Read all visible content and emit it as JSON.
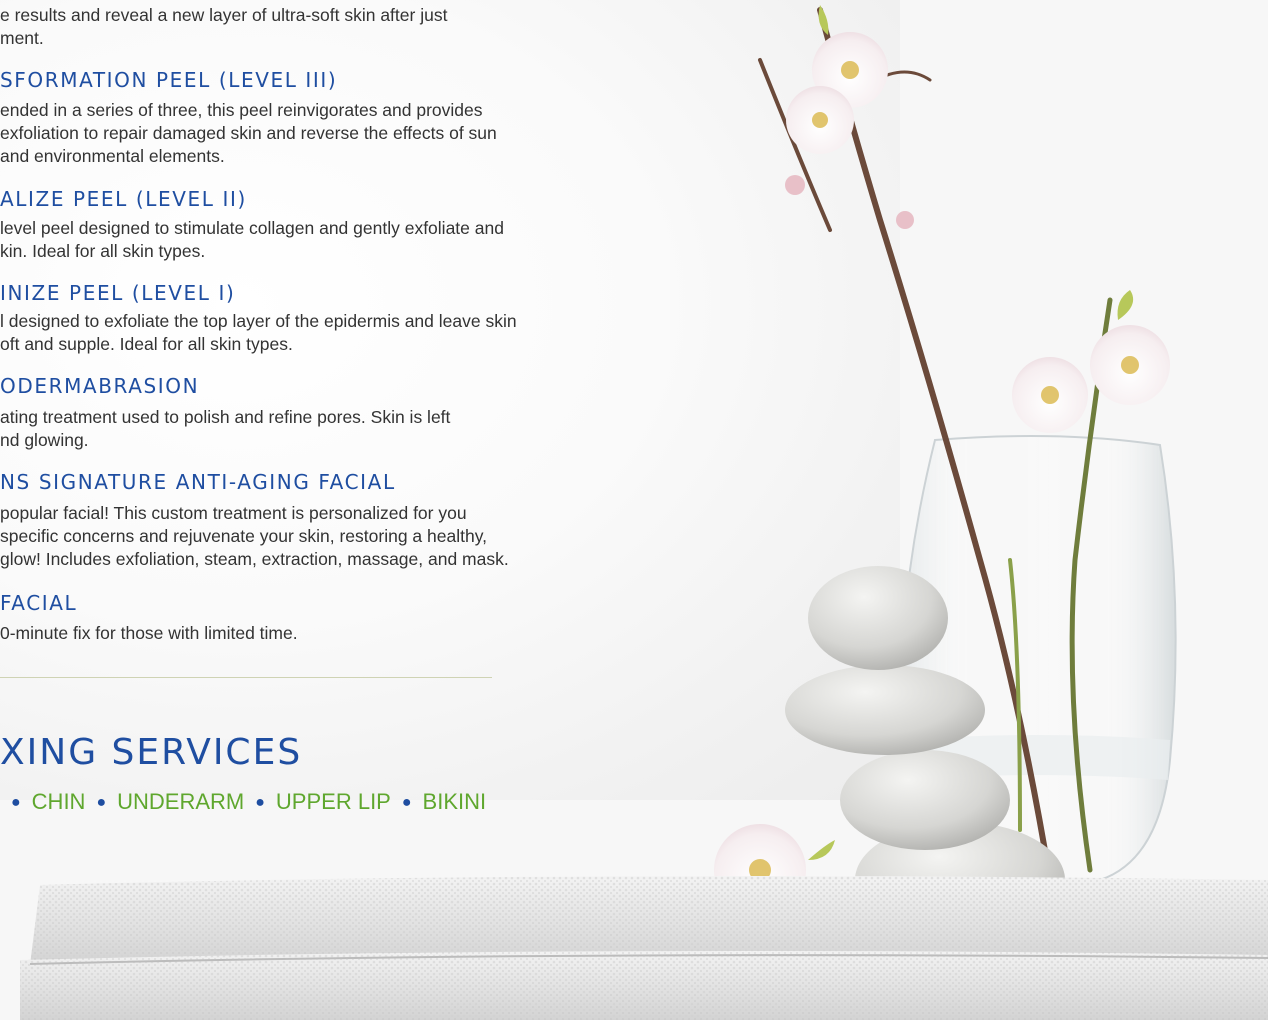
{
  "services": [
    {
      "title": "",
      "desc": [
        "e results and reveal a new layer of ultra-soft skin after just",
        "ment."
      ]
    },
    {
      "title": "SFORMATION PEEL (LEVEL III)",
      "desc": [
        "ended in a series of three, this peel reinvigorates and provides",
        " exfoliation to repair damaged skin and reverse the effects of sun",
        " and environmental elements."
      ]
    },
    {
      "title": "ALIZE PEEL (LEVEL II)",
      "desc": [
        " level peel designed to stimulate collagen and gently exfoliate and",
        "kin. Ideal for all skin types."
      ]
    },
    {
      "title": "INIZE PEEL (LEVEL I)",
      "desc": [
        "l designed to exfoliate the top layer of the epidermis and leave skin",
        "oft and supple. Ideal for all skin types."
      ]
    },
    {
      "title": "ODERMABRASION",
      "desc": [
        "ating treatment used to polish and refine pores. Skin is left",
        "nd glowing."
      ]
    },
    {
      "title": "NS SIGNATURE ANTI-AGING FACIAL",
      "desc": [
        " popular facial! This custom treatment is personalized for you",
        "specific concerns and rejuvenate your skin, restoring a healthy,",
        "glow! Includes exfoliation, steam, extraction, massage, and mask."
      ]
    },
    {
      "title": "FACIAL",
      "desc": [
        "0-minute fix for those with limited time."
      ]
    }
  ],
  "waxing": {
    "title": "XING SERVICES",
    "items": [
      "CHIN",
      "UNDERARM",
      "UPPER LIP",
      "BIKINI"
    ]
  },
  "colors": {
    "title_blue": "#1f4ea1",
    "wax_green": "#5fa72e",
    "body_text": "#333333"
  },
  "photo": {
    "icons": [
      "cherry-blossom-branch",
      "glass-vase",
      "zen-stone-stack",
      "white-towel"
    ]
  }
}
